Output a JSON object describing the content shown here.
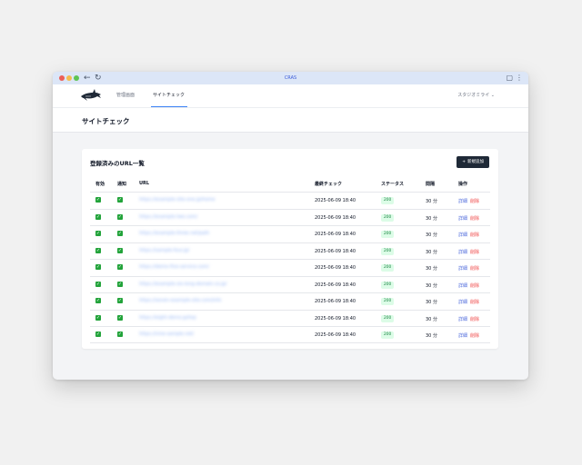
{
  "browser": {
    "title": "CRAS"
  },
  "nav": {
    "admin": "管理画面",
    "site_check": "サイトチェック",
    "user_menu": "スタジオミライ ⌄"
  },
  "page": {
    "title": "サイトチェック"
  },
  "card": {
    "title": "登録済みのURL一覧",
    "add_button": "新規追加"
  },
  "table": {
    "headers": {
      "active": "有効",
      "notify": "通知",
      "url": "URL",
      "last_check": "最終チェック",
      "status": "ステータス",
      "interval": "間隔",
      "ops": "操作"
    },
    "rows": [
      {
        "url": "https://example-site-one.jp/home",
        "last_check": "2025-06-09 18:40",
        "status": "200",
        "interval": "30 分",
        "detail": "詳細",
        "delete": "削除"
      },
      {
        "url": "https://example-two.com/",
        "last_check": "2025-06-09 18:40",
        "status": "200",
        "interval": "30 分",
        "detail": "詳細",
        "delete": "削除"
      },
      {
        "url": "https://example-three.net/path",
        "last_check": "2025-06-09 18:40",
        "status": "200",
        "interval": "30 分",
        "detail": "詳細",
        "delete": "削除"
      },
      {
        "url": "https://sample-four.jp/",
        "last_check": "2025-06-09 18:40",
        "status": "200",
        "interval": "30 分",
        "detail": "詳細",
        "delete": "削除"
      },
      {
        "url": "https://demo-five-service.com/",
        "last_check": "2025-06-09 18:40",
        "status": "200",
        "interval": "30 分",
        "detail": "詳細",
        "delete": "削除"
      },
      {
        "url": "https://example-six-long-domain.co.jp/",
        "last_check": "2025-06-09 18:40",
        "status": "200",
        "interval": "30 分",
        "detail": "詳細",
        "delete": "削除"
      },
      {
        "url": "https://seven-example-site.com/info",
        "last_check": "2025-06-09 18:40",
        "status": "200",
        "interval": "30 分",
        "detail": "詳細",
        "delete": "削除"
      },
      {
        "url": "https://eight-demo.jp/top",
        "last_check": "2025-06-09 18:40",
        "status": "200",
        "interval": "30 分",
        "detail": "詳細",
        "delete": "削除"
      },
      {
        "url": "https://nine-sample.net/",
        "last_check": "2025-06-09 18:40",
        "status": "200",
        "interval": "30 分",
        "detail": "詳細",
        "delete": "削除"
      }
    ]
  },
  "colors": {
    "accent": "#3b82f6",
    "success": "#22a33a",
    "danger": "#ef4444",
    "link": "#4f6bdc",
    "button_bg": "#1f2937"
  }
}
